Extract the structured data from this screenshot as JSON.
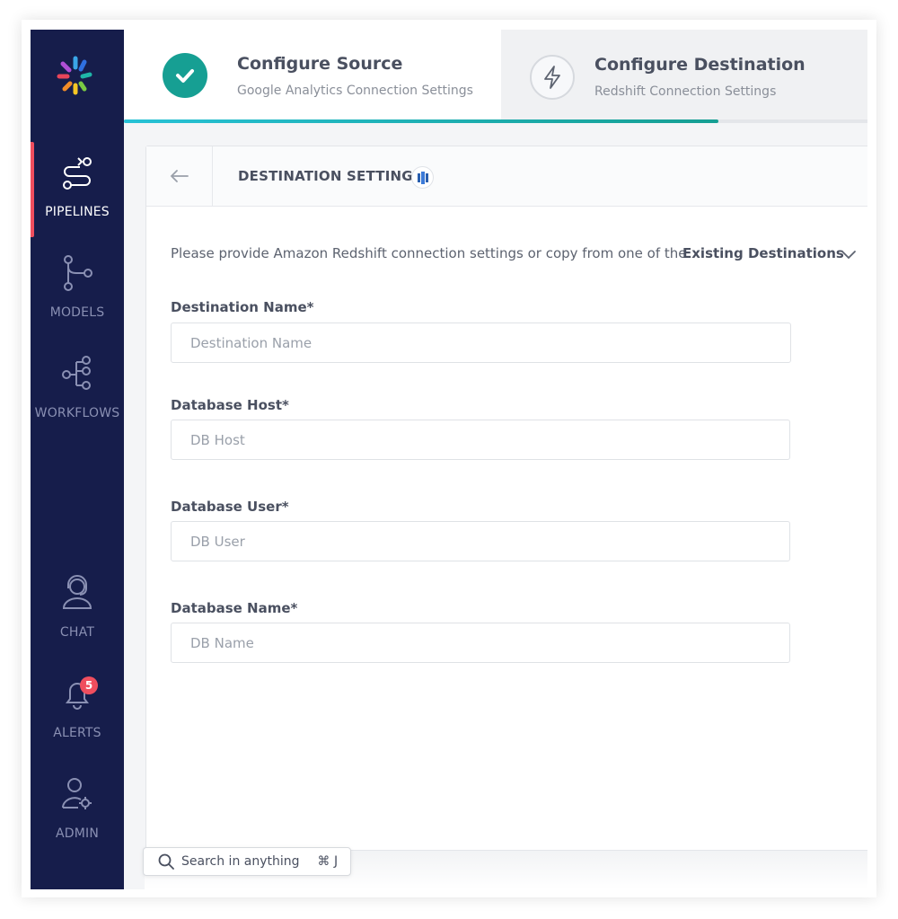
{
  "sidebar": {
    "items": [
      {
        "label": "PIPELINES",
        "icon": "pipelines-icon",
        "active": true
      },
      {
        "label": "MODELS",
        "icon": "models-icon",
        "active": false
      },
      {
        "label": "WORKFLOWS",
        "icon": "workflows-icon",
        "active": false
      },
      {
        "label": "CHAT",
        "icon": "chat-icon",
        "active": false
      },
      {
        "label": "ALERTS",
        "icon": "bell-icon",
        "active": false,
        "badge": "5"
      },
      {
        "label": "ADMIN",
        "icon": "admin-icon",
        "active": false
      }
    ]
  },
  "stepper": {
    "steps": [
      {
        "title": "Configure Source",
        "subtitle": "Google Analytics Connection Settings",
        "status": "complete",
        "icon": "check-icon"
      },
      {
        "title": "Configure Destination",
        "subtitle": "Redshift Connection Settings",
        "status": "current",
        "icon": "lightning-icon"
      }
    ],
    "progress": 0.8
  },
  "panel": {
    "title": "DESTINATION SETTINGS",
    "title_icon": "redshift-icon",
    "intro": "Please provide Amazon Redshift connection settings or copy from one of the",
    "existing_link": "Existing Destinations",
    "fields": [
      {
        "label": "Destination Name*",
        "placeholder": "Destination Name",
        "value": ""
      },
      {
        "label": "Database Host*",
        "placeholder": "DB Host",
        "value": ""
      },
      {
        "label": "Database User*",
        "placeholder": "DB User",
        "value": ""
      },
      {
        "label": "Database Name*",
        "placeholder": "DB Name",
        "value": ""
      }
    ]
  },
  "search": {
    "placeholder": "Search in anything",
    "shortcut": "⌘ J"
  },
  "colors": {
    "sidebar_bg": "#161d4b",
    "active_accent": "#f04e5e",
    "success": "#169f93",
    "progress_start": "#27c2d6"
  }
}
